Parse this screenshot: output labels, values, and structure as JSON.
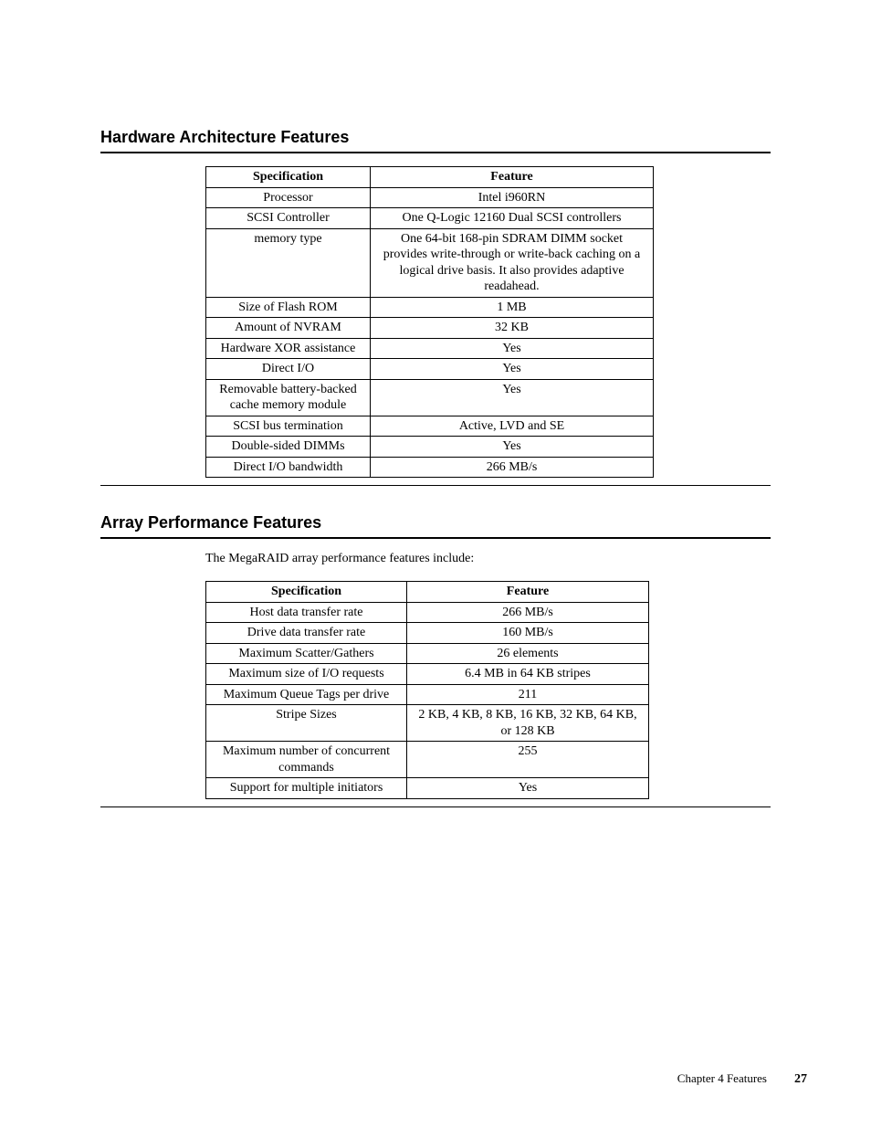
{
  "section1": {
    "heading": "Hardware Architecture Features",
    "headers": {
      "spec": "Specification",
      "feat": "Feature"
    },
    "rows": [
      {
        "spec": "Processor",
        "feat": "Intel i960RN"
      },
      {
        "spec": "SCSI Controller",
        "feat": "One Q-Logic 12160 Dual SCSI controllers"
      },
      {
        "spec": "memory type",
        "feat": "One 64-bit 168-pin SDRAM DIMM socket provides write-through or write-back caching on a logical drive basis. It also provides adaptive readahead."
      },
      {
        "spec": "Size of Flash ROM",
        "feat": "1 MB"
      },
      {
        "spec": "Amount of NVRAM",
        "feat": "32 KB"
      },
      {
        "spec": "Hardware XOR assistance",
        "feat": "Yes"
      },
      {
        "spec": "Direct I/O",
        "feat": "Yes"
      },
      {
        "spec": "Removable battery-backed cache memory module",
        "feat": "Yes"
      },
      {
        "spec": "SCSI bus termination",
        "feat": "Active, LVD and SE"
      },
      {
        "spec": "Double-sided DIMMs",
        "feat": "Yes"
      },
      {
        "spec": "Direct I/O bandwidth",
        "feat": "266 MB/s"
      }
    ]
  },
  "section2": {
    "heading": "Array Performance Features",
    "intro": "The MegaRAID array performance features include:",
    "headers": {
      "spec": "Specification",
      "feat": "Feature"
    },
    "rows": [
      {
        "spec": "Host data transfer rate",
        "feat": "266 MB/s"
      },
      {
        "spec": "Drive data transfer rate",
        "feat": "160 MB/s"
      },
      {
        "spec": "Maximum Scatter/Gathers",
        "feat": "26 elements"
      },
      {
        "spec": "Maximum size of I/O requests",
        "feat": "6.4 MB in 64 KB stripes"
      },
      {
        "spec": "Maximum Queue Tags per drive",
        "feat": "211"
      },
      {
        "spec": "Stripe Sizes",
        "feat": "2 KB, 4 KB, 8 KB, 16 KB, 32 KB, 64 KB, or 128 KB"
      },
      {
        "spec": "Maximum number of concurrent commands",
        "feat": "255"
      },
      {
        "spec": "Support for multiple initiators",
        "feat": "Yes"
      }
    ]
  },
  "footer": {
    "chapter": "Chapter 4 Features",
    "page": "27"
  },
  "table1_widths": {
    "col1": 180,
    "col2": 310
  },
  "table2_widths": {
    "col1": 220,
    "col2": 265
  }
}
